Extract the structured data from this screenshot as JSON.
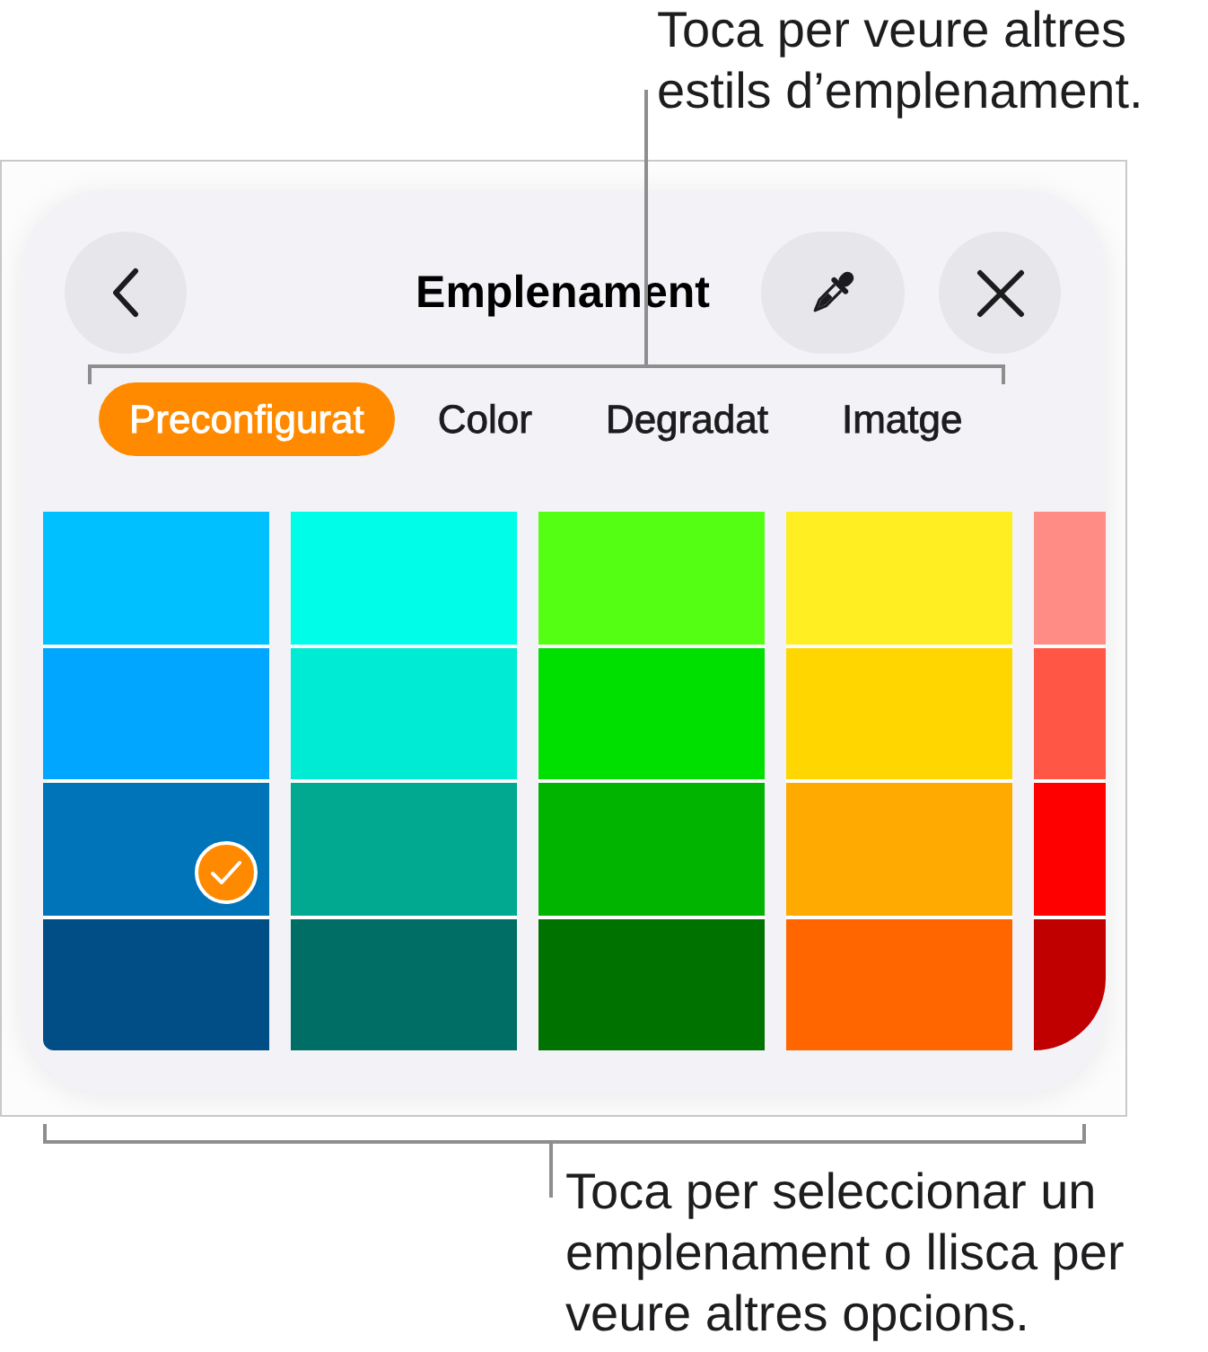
{
  "callout_top": {
    "text": "Toca per veure altres estils d’emplenament."
  },
  "panel": {
    "title": "Emplenament"
  },
  "tabs": [
    {
      "label": "Preconfigurat",
      "selected": true
    },
    {
      "label": "Color",
      "selected": false
    },
    {
      "label": "Degradat",
      "selected": false
    },
    {
      "label": "Imatge",
      "selected": false
    }
  ],
  "swatch_columns": [
    {
      "cells": [
        {
          "color": "#00c0ff",
          "selected": false
        },
        {
          "color": "#00a6ff",
          "selected": false
        },
        {
          "color": "#0074b9",
          "selected": true
        },
        {
          "color": "#004e85",
          "selected": false
        }
      ]
    },
    {
      "cells": [
        {
          "color": "#00fde7",
          "selected": false
        },
        {
          "color": "#00ebd3",
          "selected": false
        },
        {
          "color": "#00a98f",
          "selected": false
        },
        {
          "color": "#006e65",
          "selected": false
        }
      ]
    },
    {
      "cells": [
        {
          "color": "#55ff14",
          "selected": false
        },
        {
          "color": "#00e000",
          "selected": false
        },
        {
          "color": "#00b400",
          "selected": false
        },
        {
          "color": "#007200",
          "selected": false
        }
      ]
    },
    {
      "cells": [
        {
          "color": "#ffee22",
          "selected": false
        },
        {
          "color": "#ffd600",
          "selected": false
        },
        {
          "color": "#ffaa00",
          "selected": false
        },
        {
          "color": "#ff6600",
          "selected": false
        }
      ]
    },
    {
      "cells": [
        {
          "color": "#ff8d85",
          "selected": false
        },
        {
          "color": "#ff5645",
          "selected": false
        },
        {
          "color": "#ff0000",
          "selected": false
        },
        {
          "color": "#c00000",
          "selected": false
        }
      ]
    }
  ],
  "callout_bottom": {
    "text": "Toca per seleccionar un emplenament o llisca per veure altres opcions."
  }
}
